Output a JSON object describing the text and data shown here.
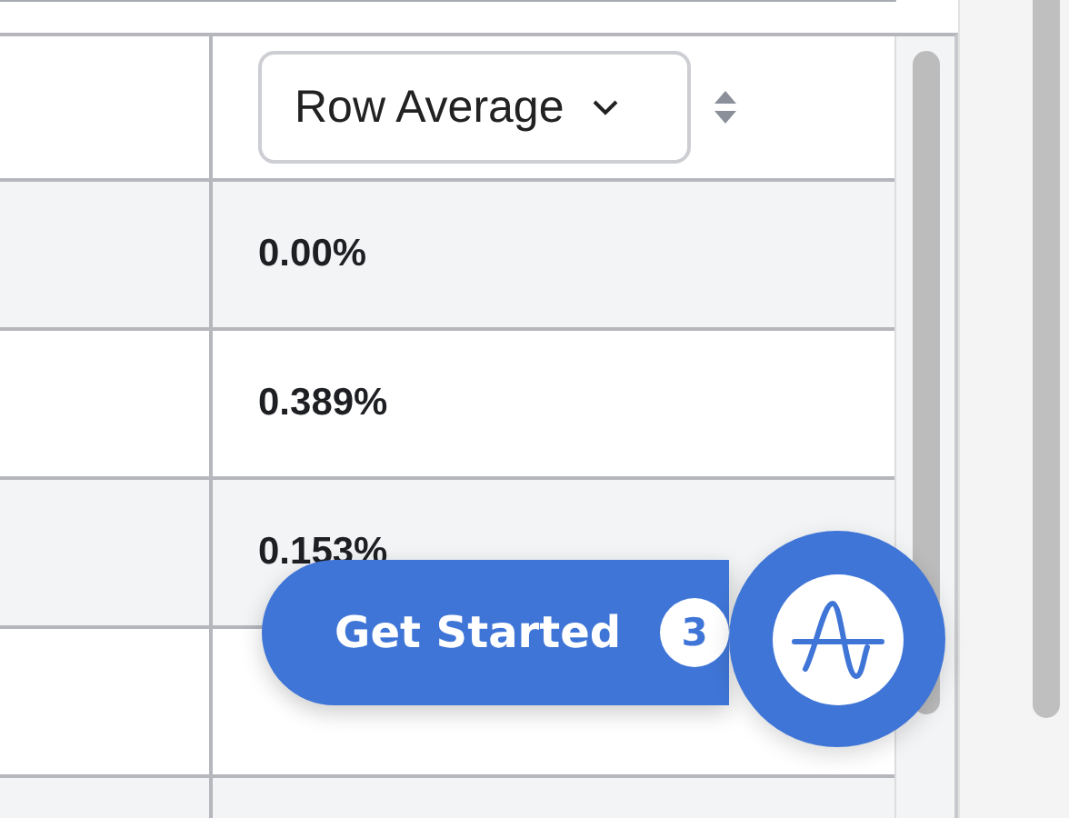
{
  "table": {
    "header": {
      "dropdown": "Row Average"
    },
    "rows": [
      {
        "value": "0.00%"
      },
      {
        "value": "0.389%"
      },
      {
        "value": "0.153%"
      },
      {}
    ]
  },
  "launcher": {
    "label": "Get Started",
    "badge": "3"
  }
}
